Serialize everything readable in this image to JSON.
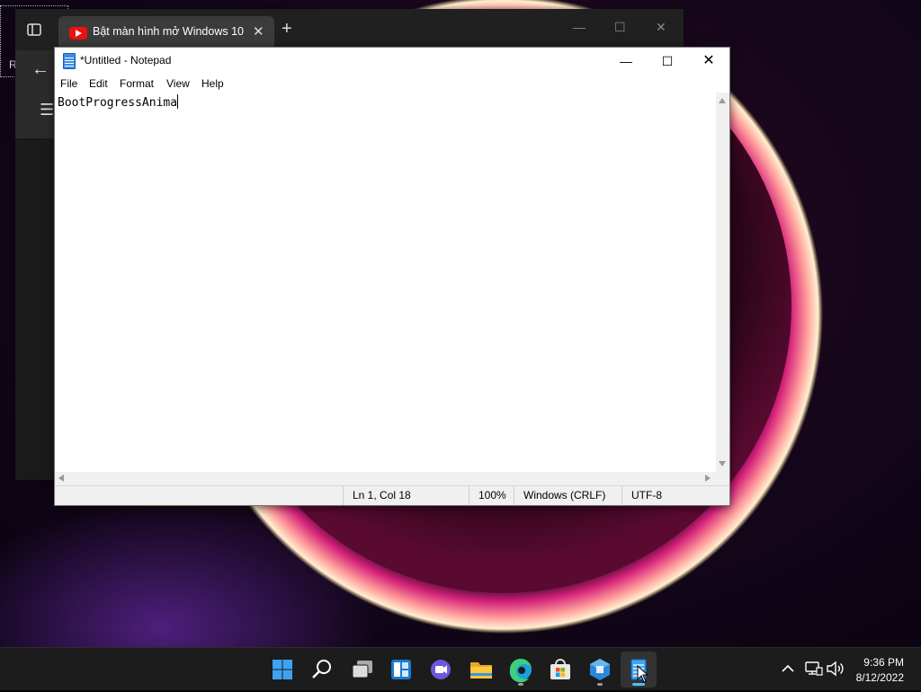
{
  "desktop": {
    "selection_label": "R"
  },
  "browser": {
    "tab_title": "Bật màn hình mở Windows 10X",
    "tab_close": "✕",
    "new_tab": "+",
    "minimize": "—",
    "maximize": "☐",
    "close": "✕",
    "back": "←",
    "menu": "☰"
  },
  "notepad": {
    "title": "*Untitled - Notepad",
    "controls": {
      "minimize": "—",
      "maximize": "☐",
      "close": "✕"
    },
    "menu": [
      "File",
      "Edit",
      "Format",
      "View",
      "Help"
    ],
    "content": "BootProgressAnima",
    "status": {
      "position": "Ln 1, Col 18",
      "zoom": "100%",
      "line_ending": "Windows (CRLF)",
      "encoding": "UTF-8"
    }
  },
  "taskbar": {
    "apps": [
      {
        "name": "start",
        "running": false,
        "active": false
      },
      {
        "name": "search",
        "running": false,
        "active": false
      },
      {
        "name": "task-view",
        "running": false,
        "active": false
      },
      {
        "name": "widgets",
        "running": false,
        "active": false
      },
      {
        "name": "teams-chat",
        "running": false,
        "active": false
      },
      {
        "name": "file-explorer",
        "running": false,
        "active": false
      },
      {
        "name": "edge",
        "running": true,
        "active": false
      },
      {
        "name": "microsoft-store",
        "running": false,
        "active": false
      },
      {
        "name": "dev-tool",
        "running": true,
        "active": false
      },
      {
        "name": "notepad",
        "running": true,
        "active": true
      }
    ],
    "tray": {
      "chevron": "^",
      "time": "9:36 PM",
      "date": "8/12/2022"
    }
  },
  "colors": {
    "accent": "#4cc2ff",
    "taskbar_bg": "#1c1c1c",
    "youtube_red": "#ee1111"
  }
}
